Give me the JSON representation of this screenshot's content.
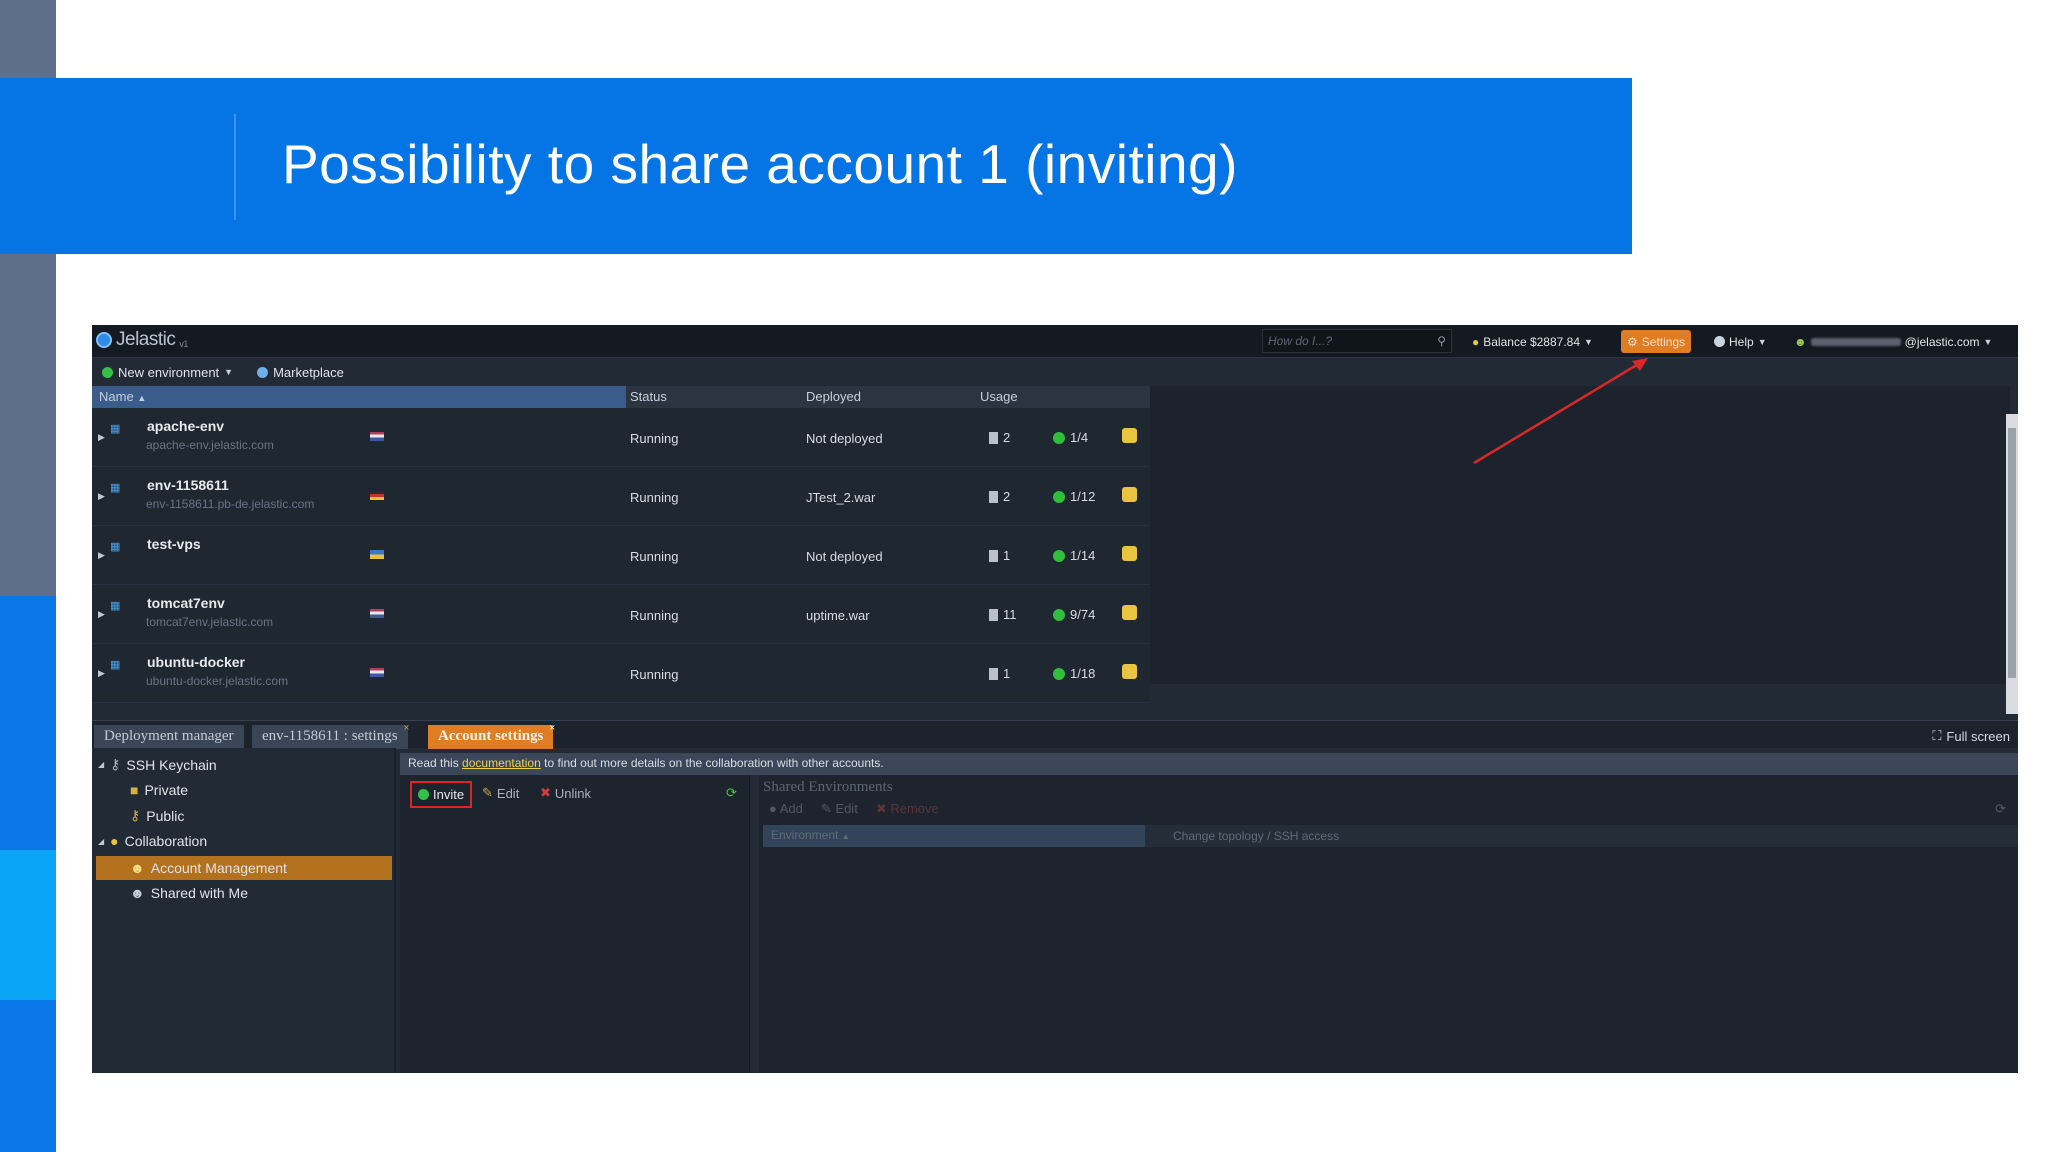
{
  "slide": {
    "title": "Possibility to share account 1 (inviting)"
  },
  "app": {
    "logo": "Jelastic",
    "logo_sub": "v1",
    "search": {
      "placeholder": "How do I...?"
    },
    "balance": "Balance $2887.84",
    "settings": "Settings",
    "help": "Help",
    "user_email": "@jelastic.com",
    "toolbar": {
      "new_env": "New environment",
      "marketplace": "Marketplace"
    },
    "grid": {
      "columns": {
        "name": "Name",
        "status": "Status",
        "deployed": "Deployed",
        "usage": "Usage"
      },
      "rows": [
        {
          "name": "apache-env",
          "domain": "apache-env.jelastic.com",
          "status": "Running",
          "deployed": "Not deployed",
          "nodes": "2",
          "cloudlets": "1/4"
        },
        {
          "name": "env-1158611",
          "domain": "env-1158611.pb-de.jelastic.com",
          "status": "Running",
          "deployed": "JTest_2.war",
          "nodes": "2",
          "cloudlets": "1/12"
        },
        {
          "name": "test-vps",
          "domain": "",
          "status": "Running",
          "deployed": "Not deployed",
          "nodes": "1",
          "cloudlets": "1/14"
        },
        {
          "name": "tomcat7env",
          "domain": "tomcat7env.jelastic.com",
          "status": "Running",
          "deployed": "uptime.war",
          "nodes": "11",
          "cloudlets": "9/74"
        },
        {
          "name": "ubuntu-docker",
          "domain": "ubuntu-docker.jelastic.com",
          "status": "Running",
          "deployed": "",
          "nodes": "1",
          "cloudlets": "1/18"
        }
      ]
    },
    "tabs": {
      "deployment": "Deployment manager",
      "env_settings": "env-1158611 : settings",
      "account": "Account settings",
      "fullscreen": "Full screen"
    },
    "tree": {
      "ssh": "SSH Keychain",
      "private": "Private",
      "public": "Public",
      "collab": "Collaboration",
      "account_mgmt": "Account Management",
      "shared": "Shared with Me"
    },
    "info": {
      "prefix": "Read this",
      "link": "documentation",
      "suffix": "to find out more details on the collaboration with other accounts."
    },
    "mid": {
      "invite": "Invite",
      "edit": "Edit",
      "unlink": "Unlink"
    },
    "shared_env": {
      "title": "Shared Environments",
      "add": "Add",
      "edit": "Edit",
      "remove": "Remove",
      "col_env": "Environment",
      "col_topo": "Change topology / SSH access"
    },
    "colors": {
      "accent": "#e07c22",
      "banner": "#0575e6",
      "highlight": "#e02424"
    }
  }
}
